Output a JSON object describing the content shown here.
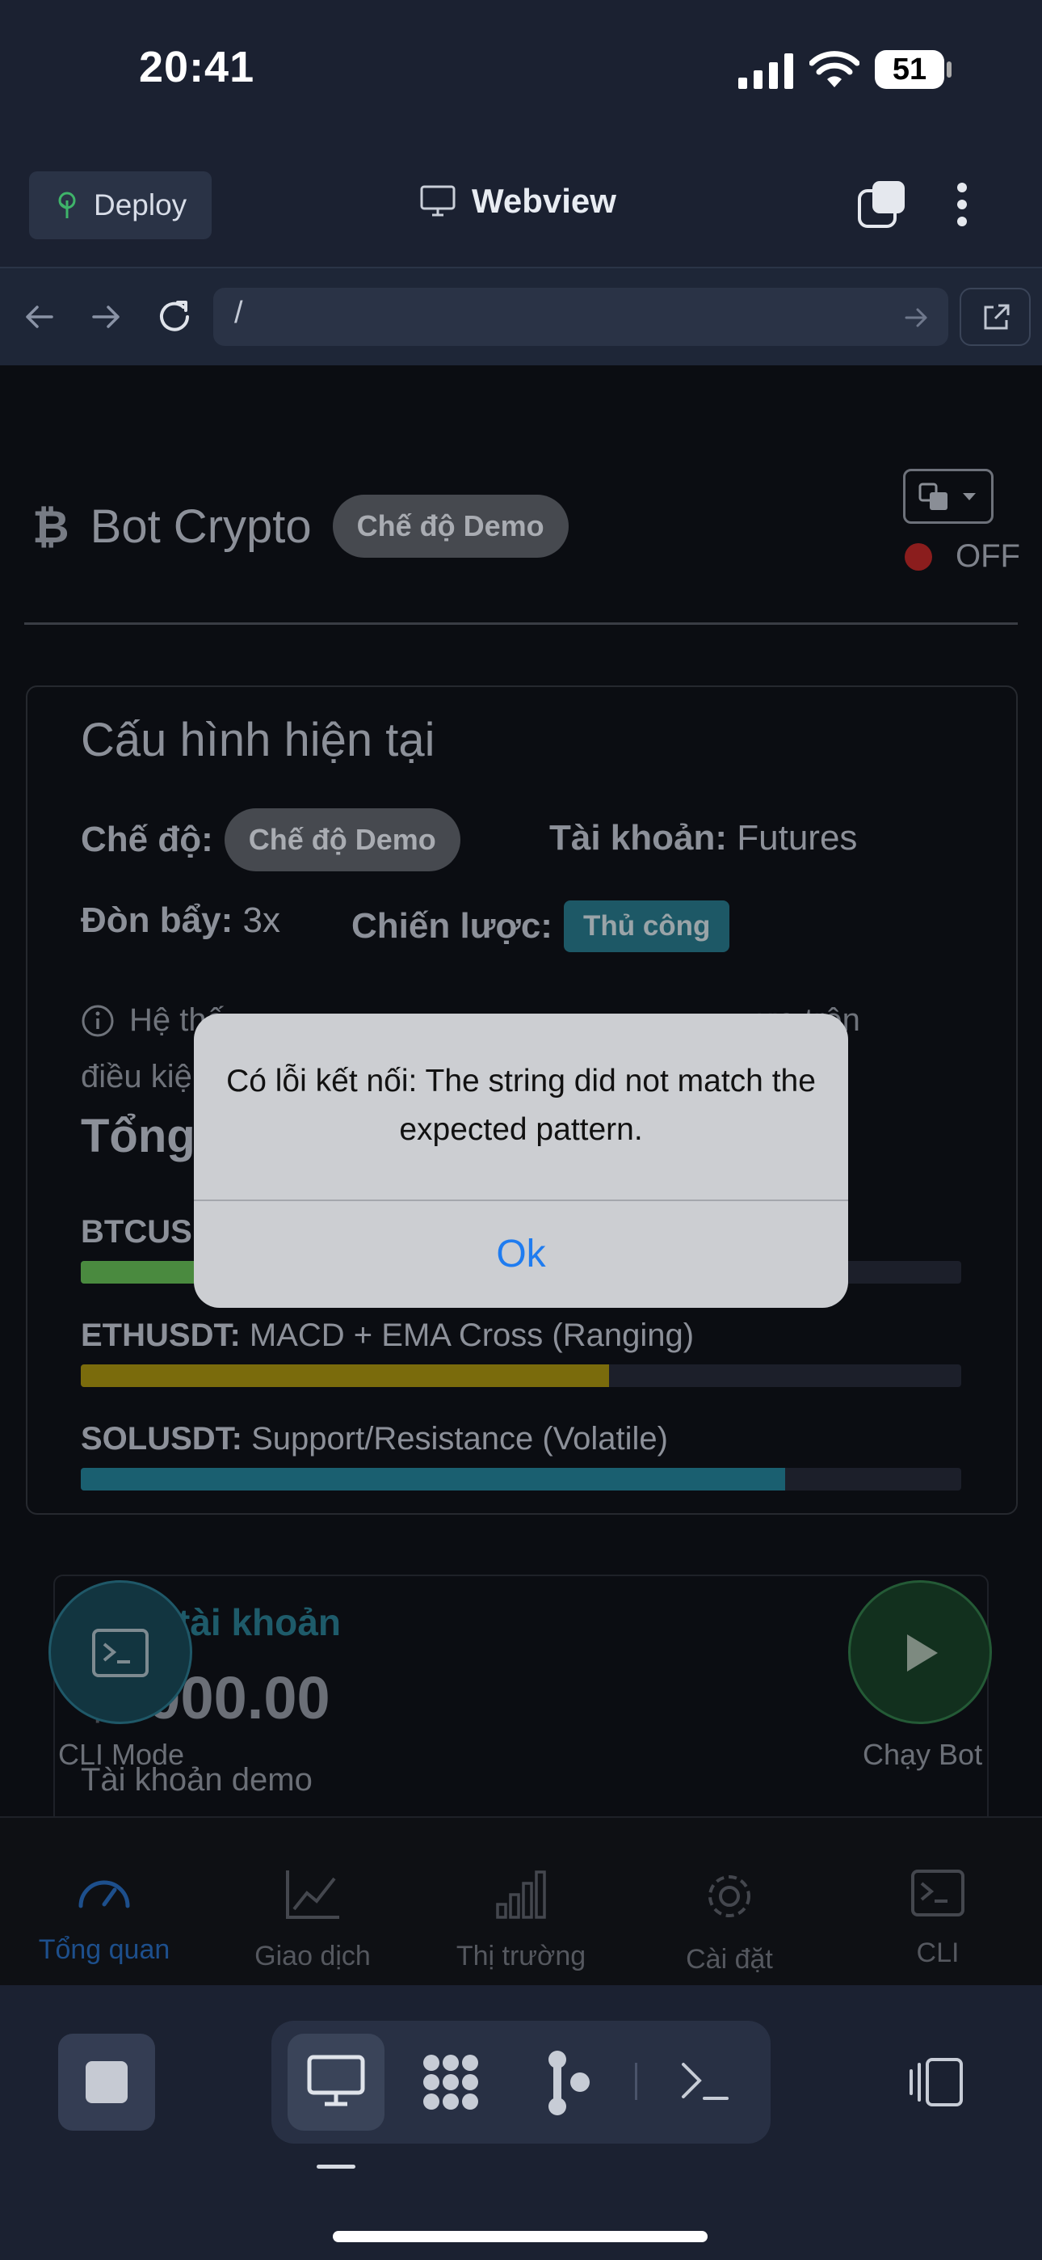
{
  "status_bar": {
    "time": "20:41",
    "battery": "51"
  },
  "header": {
    "deploy_label": "Deploy",
    "webview_title": "Webview"
  },
  "url_bar": {
    "url": "/"
  },
  "app": {
    "title": "Bot Crypto",
    "mode_badge": "Chế độ Demo",
    "bot_status": "OFF",
    "config": {
      "title": "Cấu hình hiện tại",
      "mode_label": "Chế độ:",
      "mode_value": "Chế độ Demo",
      "account_label": "Tài khoản:",
      "account_value": "Futures",
      "leverage_label": "Đòn bẩy:",
      "leverage_value": "3x",
      "strategy_label": "Chiến lược:",
      "strategy_value": "Thủ công",
      "info_line1_start": "Hệ thố",
      "info_line1_end": "ựa trên",
      "info_line2": "điều kiệ",
      "overview_title": "Tổng",
      "pairs": [
        {
          "symbol": "BTCUSI",
          "strategy": "",
          "progress": 0.15,
          "color": "#4a8a3f"
        },
        {
          "symbol": "ETHUSDT:",
          "strategy": "MACD + EMA Cross (Ranging)",
          "progress": 0.6,
          "color": "#7a6b0c"
        },
        {
          "symbol": "SOLUSDT:",
          "strategy": "Support/Resistance (Volatile)",
          "progress": 0.8,
          "color": "#1a5f70"
        }
      ]
    },
    "balance": {
      "title": "tài khoản",
      "value": "0000.00",
      "sub": "Tài khoản demo"
    },
    "fabs": {
      "cli_label": "CLI Mode",
      "run_label": "Chạy Bot"
    },
    "nav": [
      {
        "label": "Tổng quan",
        "icon": "gauge-icon",
        "active": true
      },
      {
        "label": "Giao dịch",
        "icon": "chart-line-icon",
        "active": false
      },
      {
        "label": "Thị trường",
        "icon": "bar-chart-icon",
        "active": false
      },
      {
        "label": "Cài đặt",
        "icon": "gear-icon",
        "active": false
      },
      {
        "label": "CLI",
        "icon": "terminal-icon",
        "active": false
      }
    ]
  },
  "alert": {
    "message": "Có lỗi kết nối: The string did not match the expected pattern.",
    "ok_label": "Ok"
  }
}
